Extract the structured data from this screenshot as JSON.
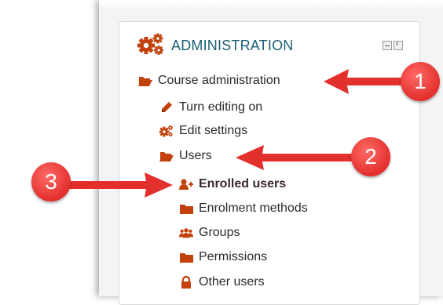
{
  "block": {
    "title": "ADMINISTRATION",
    "icon": "gears-icon",
    "controls": [
      "minimize-block-icon",
      "dock-block-icon"
    ]
  },
  "menu": [
    {
      "label": "Course administration",
      "icon": "folder-open-icon"
    },
    {
      "label": "Turn editing on",
      "icon": "pencil-icon"
    },
    {
      "label": "Edit settings",
      "icon": "gears-icon"
    },
    {
      "label": "Users",
      "icon": "folder-open-icon"
    },
    {
      "label": "Enrolled users",
      "icon": "user-plus-icon",
      "active": true
    },
    {
      "label": "Enrolment methods",
      "icon": "folder-icon"
    },
    {
      "label": "Groups",
      "icon": "users-icon"
    },
    {
      "label": "Permissions",
      "icon": "folder-icon"
    },
    {
      "label": "Other users",
      "icon": "lock-icon"
    }
  ],
  "callouts": [
    {
      "number": "1"
    },
    {
      "number": "2"
    },
    {
      "number": "3"
    }
  ],
  "colors": {
    "icon": "#c2410c",
    "title": "#1b5f73",
    "callout": "#e2302d"
  }
}
